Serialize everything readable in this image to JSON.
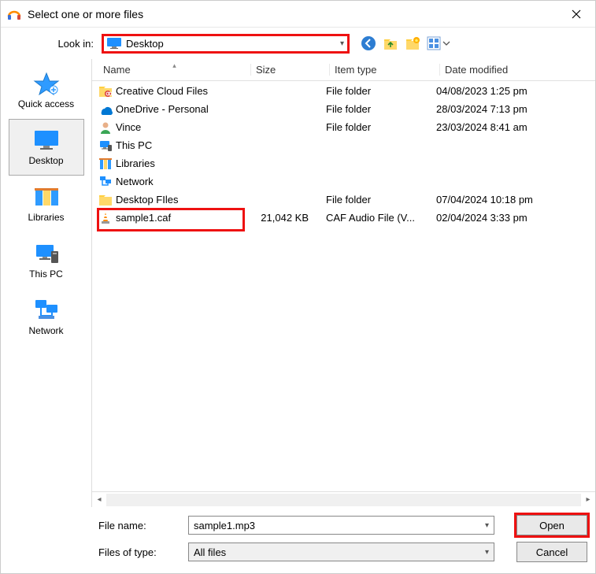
{
  "title": "Select one or more files",
  "lookin_label": "Look in:",
  "lookin_value": "Desktop",
  "toolbar_icons": [
    "back",
    "up",
    "new-folder",
    "view-menu"
  ],
  "places": [
    {
      "id": "quick-access",
      "label": "Quick access"
    },
    {
      "id": "desktop",
      "label": "Desktop"
    },
    {
      "id": "libraries",
      "label": "Libraries"
    },
    {
      "id": "this-pc",
      "label": "This PC"
    },
    {
      "id": "network",
      "label": "Network"
    }
  ],
  "selected_place": "desktop",
  "columns": {
    "name": "Name",
    "size": "Size",
    "type": "Item type",
    "date": "Date modified"
  },
  "rows": [
    {
      "icon": "folder-cc",
      "name": "Creative Cloud Files",
      "size": "",
      "type": "File folder",
      "date": "04/08/2023 1:25 pm"
    },
    {
      "icon": "onedrive",
      "name": "OneDrive - Personal",
      "size": "",
      "type": "File folder",
      "date": "28/03/2024 7:13 pm"
    },
    {
      "icon": "user",
      "name": "Vince",
      "size": "",
      "type": "File folder",
      "date": "23/03/2024 8:41 am"
    },
    {
      "icon": "thispc",
      "name": "This PC",
      "size": "",
      "type": "",
      "date": ""
    },
    {
      "icon": "libraries",
      "name": "Libraries",
      "size": "",
      "type": "",
      "date": ""
    },
    {
      "icon": "network",
      "name": "Network",
      "size": "",
      "type": "",
      "date": ""
    },
    {
      "icon": "folder",
      "name": "Desktop FIles",
      "size": "",
      "type": "File folder",
      "date": "07/04/2024 10:18 pm"
    },
    {
      "icon": "vlc",
      "name": "sample1.caf",
      "size": "21,042 KB",
      "type": "CAF Audio File (V...",
      "date": "02/04/2024 3:33 pm"
    }
  ],
  "filename_label": "File name:",
  "filename_value": "sample1.mp3",
  "filetype_label": "Files of type:",
  "filetype_value": "All files",
  "open_label": "Open",
  "cancel_label": "Cancel"
}
